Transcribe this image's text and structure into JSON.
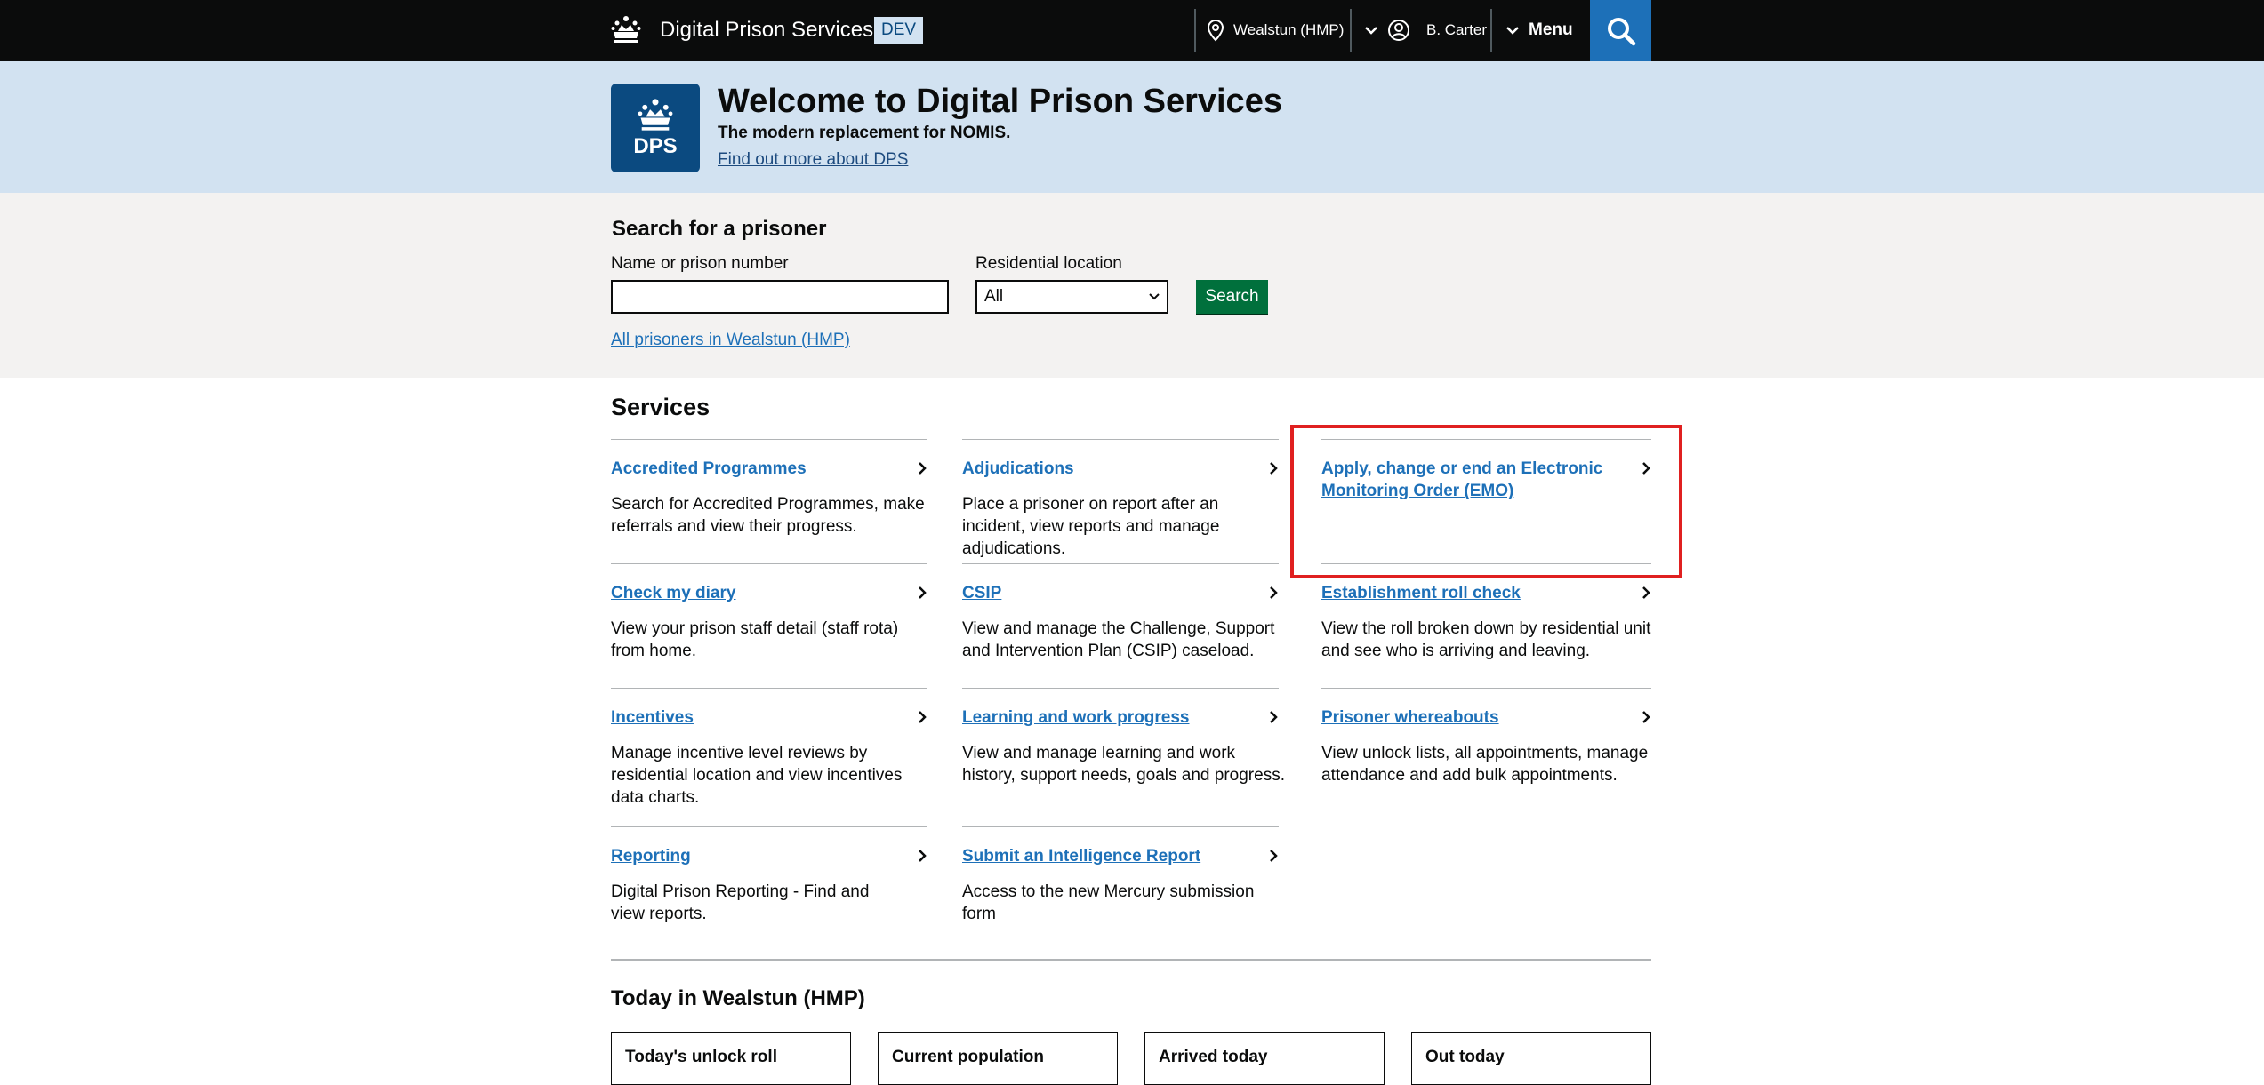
{
  "header": {
    "app_title": "Digital Prison Services",
    "env_tag": "DEV",
    "location": "Wealstun (HMP)",
    "user": "B. Carter",
    "menu_label": "Menu"
  },
  "banner": {
    "logo_text": "DPS",
    "title": "Welcome to Digital Prison Services",
    "subtitle": "The modern replacement for NOMIS.",
    "link": "Find out more about DPS"
  },
  "search": {
    "title": "Search for a prisoner",
    "name_label": "Name or prison number",
    "name_value": "",
    "location_label": "Residential location",
    "location_value": "All",
    "button": "Search",
    "all_link": "All prisoners in Wealstun (HMP)"
  },
  "services": {
    "title": "Services",
    "items": [
      {
        "title": "Accredited Programmes",
        "desc": "Search for Accredited Programmes, make referrals and view their progress."
      },
      {
        "title": "Adjudications",
        "desc": "Place a prisoner on report after an incident, view reports and manage adjudications."
      },
      {
        "title": "Apply, change or end an Electronic Monitoring Order (EMO)",
        "desc": ""
      },
      {
        "title": "Check my diary",
        "desc": "View your prison staff detail (staff rota) from home."
      },
      {
        "title": "CSIP",
        "desc": "View and manage the Challenge, Support and Intervention Plan (CSIP) caseload."
      },
      {
        "title": "Establishment roll check",
        "desc": "View the roll broken down by residential unit and see who is arriving and leaving."
      },
      {
        "title": "Incentives",
        "desc": "Manage incentive level reviews by residential location and view incentives data charts."
      },
      {
        "title": "Learning and work progress",
        "desc": "View and manage learning and work history, support needs, goals and progress."
      },
      {
        "title": "Prisoner whereabouts",
        "desc": "View unlock lists, all appointments, manage attendance and add bulk appointments."
      },
      {
        "title": "Reporting",
        "desc": "Digital Prison Reporting - Find and view reports."
      },
      {
        "title": "Submit an Intelligence Report",
        "desc": "Access to the new Mercury submission form"
      }
    ]
  },
  "today": {
    "title": "Today in Wealstun (HMP)",
    "cards": [
      "Today's unlock roll",
      "Current population",
      "Arrived today",
      "Out today"
    ]
  }
}
